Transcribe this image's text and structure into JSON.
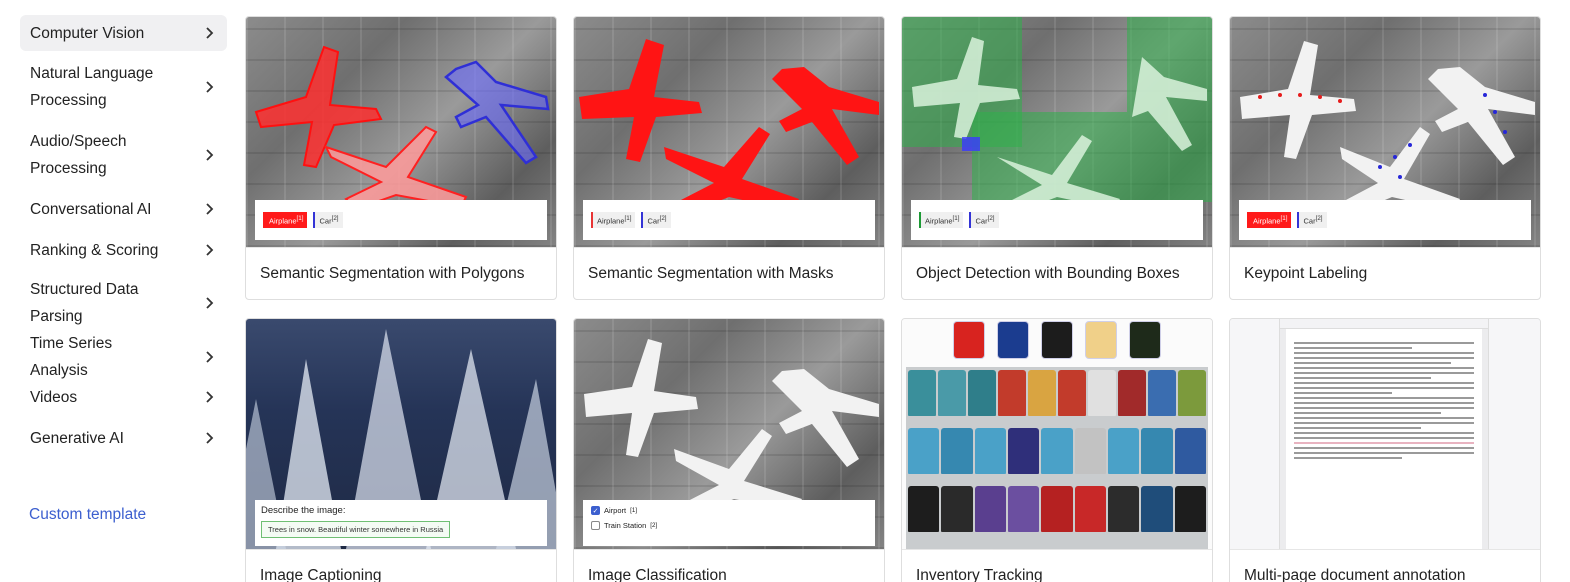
{
  "sidebar": {
    "items": [
      {
        "label": "Computer Vision"
      },
      {
        "label": "Natural Language Processing"
      },
      {
        "label": "Audio/Speech Processing"
      },
      {
        "label": "Conversational AI"
      },
      {
        "label": "Ranking & Scoring"
      },
      {
        "label": "Structured Data Parsing"
      },
      {
        "label": "Time Series Analysis"
      },
      {
        "label": "Videos"
      },
      {
        "label": "Generative AI"
      }
    ],
    "custom_template": "Custom template"
  },
  "cards": [
    {
      "title": "Semantic Segmentation with Polygons",
      "labels": [
        {
          "text": "Airplane",
          "count": "[1]"
        },
        {
          "text": "Car",
          "count": "[2]"
        }
      ]
    },
    {
      "title": "Semantic Segmentation with Masks",
      "labels": [
        {
          "text": "Airplane",
          "count": "[1]"
        },
        {
          "text": "Car",
          "count": "[2]"
        }
      ]
    },
    {
      "title": "Object Detection with Bounding Boxes",
      "labels": [
        {
          "text": "Airplane",
          "count": "[1]"
        },
        {
          "text": "Car",
          "count": "[2]"
        }
      ]
    },
    {
      "title": "Keypoint Labeling",
      "labels": [
        {
          "text": "Airplane",
          "count": "[1]"
        },
        {
          "text": "Car",
          "count": "[2]"
        }
      ]
    },
    {
      "title": "Image Captioning",
      "question": "Describe the image:",
      "answer": "Trees in snow. Beautiful winter somewhere in Russia"
    },
    {
      "title": "Image Classification",
      "options": [
        {
          "text": "Airport",
          "count": "[1]",
          "checked": true
        },
        {
          "text": "Train Station",
          "count": "[2]",
          "checked": false
        }
      ]
    },
    {
      "title": "Inventory Tracking"
    },
    {
      "title": "Multi-page document annotation"
    }
  ],
  "colors": {
    "link": "#3c5fcf",
    "polygon_red": "#ff2d2d",
    "polygon_blue": "#2f2fd6",
    "box_green": "#1d9a35"
  }
}
